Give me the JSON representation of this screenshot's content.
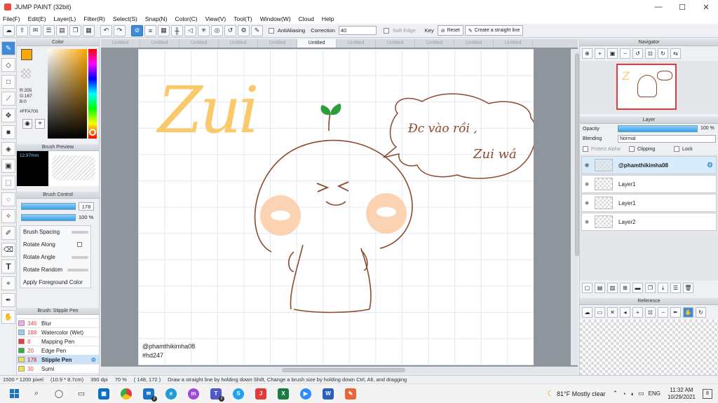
{
  "window": {
    "title": "JUMP PAINT (32bit)",
    "minimize": "—",
    "maximize": "☐",
    "close": "✕"
  },
  "menu": [
    "File(F)",
    "Edit(E)",
    "Layer(L)",
    "Filter(R)",
    "Select(S)",
    "Snap(N)",
    "Color(C)",
    "View(V)",
    "Tool(T)",
    "Window(W)",
    "Cloud",
    "Help"
  ],
  "toolbar": {
    "antialiasing_label": "AntiAliasing",
    "correction_label": "Correction",
    "correction_value": "40",
    "soft_edge_label": "Soft Edge",
    "key_label": "Key",
    "reset_label": "Reset",
    "straight_line_label": "Create a straight line"
  },
  "color_panel": {
    "title": "Color",
    "r": "R:255",
    "g": "G:167",
    "b": "B:0",
    "hex": "#FFA700",
    "fg_color": "#ffa700"
  },
  "brush_preview": {
    "title": "Brush Preview",
    "size": "12.97mm"
  },
  "brush_control": {
    "title": "Brush Control",
    "size_value": "178",
    "opacity_value": "100 %",
    "items": [
      "Brush Spacing",
      "Rotate Along",
      "Rotate Angle",
      "Rotate Random",
      "Apply Foreground Color"
    ]
  },
  "brush_list": {
    "title": "Brush: Stipple Pen",
    "items": [
      {
        "num": "346",
        "name": "Blur",
        "color": "#f4a7f0"
      },
      {
        "num": "188",
        "name": "Watercolor (Wet)",
        "color": "#8fd3f0"
      },
      {
        "num": "8",
        "name": "Mapping Pen",
        "color": "#e83a3a"
      },
      {
        "num": "20",
        "name": "Edge Pen",
        "color": "#2bb34a"
      },
      {
        "num": "178",
        "name": "Stipple Pen",
        "color": "#f1e04a"
      },
      {
        "num": "30",
        "name": "Sumi",
        "color": "#f1e04a"
      }
    ]
  },
  "tabs": [
    "Untitled",
    "Untitled",
    "Untitled",
    "Untitled",
    "Untitled",
    "Untitled",
    "Untitled",
    "Untitled",
    "Untitled",
    "Untitled",
    "Untitled"
  ],
  "artwork": {
    "zui": "Zui",
    "bubble_line1": "Đc vào rồi ,",
    "bubble_line2": "Zui wá",
    "credit1": "@phamthikimha08",
    "credit2": "#hd247"
  },
  "navigator": {
    "title": "Navigator"
  },
  "layer_panel": {
    "title": "Layer",
    "opacity_label": "Opacity",
    "opacity_value": "100 %",
    "blending_label": "Blending",
    "blending_value": "Normal",
    "protect_alpha": "Protect Alpha",
    "clipping": "Clipping",
    "lock": "Lock",
    "layers": [
      "@phamthikimha08",
      "Layer1",
      "Layer1",
      "Layer2"
    ]
  },
  "reference": {
    "title": "Reference"
  },
  "status": {
    "size": "1500 * 1200 pixel",
    "physical": "(10.9 * 8.7cm)",
    "dpi": "350 dpi",
    "zoom": "70 %",
    "coords": "( 148, 172 )",
    "hint": "Draw a straight line by holding down Shift, Change a brush size by holding down Ctrl, Alt, and dragging"
  },
  "taskbar": {
    "weather": "81°F  Mostly clear",
    "lang": "ENG",
    "time": "11:32 AM",
    "date": "10/29/2021",
    "notif": "8",
    "teams_badge": "2",
    "mail_badge": "2"
  }
}
